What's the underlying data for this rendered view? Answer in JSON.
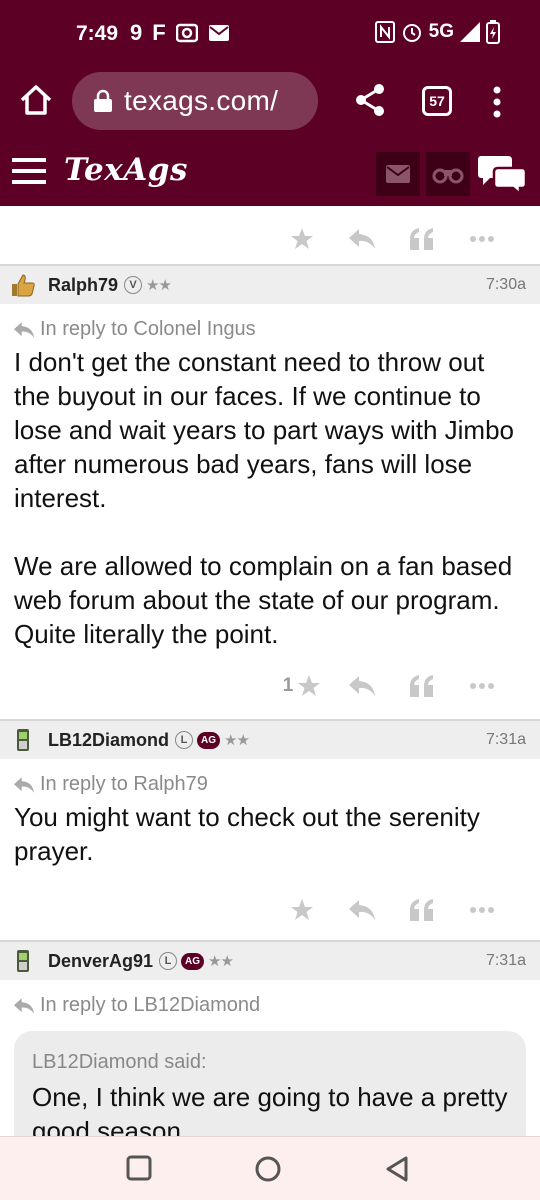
{
  "status_bar": {
    "time": "7:49",
    "left_icons": [
      "9",
      "F"
    ],
    "network": "5G"
  },
  "browser": {
    "url": "texags.com/",
    "tab_count": "57"
  },
  "app": {
    "logo": "TexAgs"
  },
  "posts": [
    {
      "username": "Ralph79",
      "badge": "V",
      "stars": "★★",
      "time": "7:30a",
      "reply_to": "In reply to Colonel Ingus",
      "paragraphs": [
        "I don't get the constant need to throw out the buyout in our faces. If we continue to lose and wait years to part ways with Jimbo after numerous bad years, fans will lose interest.",
        "We are allowed to complain on a fan based web forum about the state of our program. Quite literally the point."
      ],
      "star_count": "1"
    },
    {
      "username": "LB12Diamond",
      "badge": "L",
      "ag_badge": "AG",
      "stars": "★★",
      "time": "7:31a",
      "reply_to": "In reply to Ralph79",
      "paragraphs": [
        "You might want to check out the serenity prayer."
      ]
    },
    {
      "username": "DenverAg91",
      "badge": "L",
      "ag_badge": "AG",
      "stars": "★★",
      "time": "7:31a",
      "reply_to": "In reply to LB12Diamond",
      "quote": {
        "author": "LB12Diamond said:",
        "text": "One, I think we are going to have a pretty good season."
      }
    }
  ],
  "colors": {
    "brand": "#5c0025",
    "action_icon": "#c8c8c8",
    "header_bg": "#eeeeee"
  },
  "icons": {
    "home": "home-icon",
    "lock": "lock-icon",
    "share": "share-icon",
    "menu": "more-vert-icon",
    "hamburger": "hamburger-icon",
    "mail": "mail-icon",
    "binoculars": "binoculars-icon",
    "chat": "chat-icon",
    "star": "star-icon",
    "reply": "reply-icon",
    "quote": "quote-icon",
    "more": "more-horiz-icon"
  }
}
